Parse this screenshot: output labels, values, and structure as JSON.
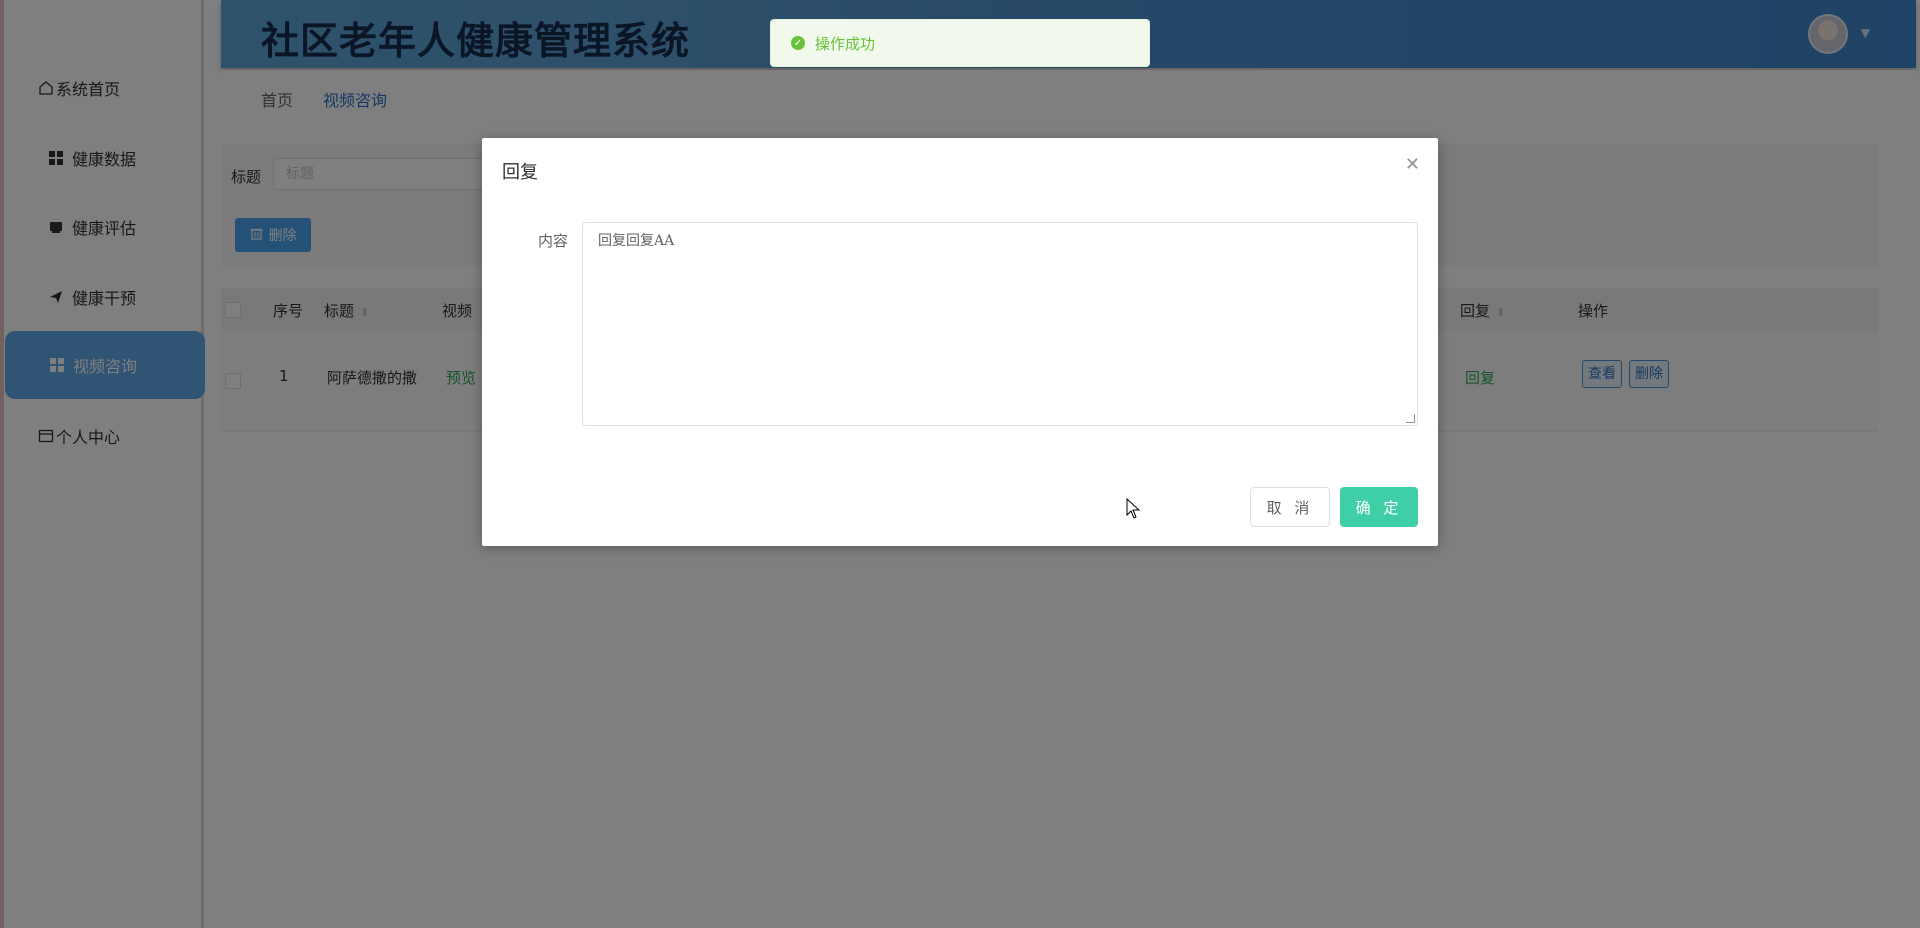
{
  "app": {
    "title": "社区老年人健康管理系统"
  },
  "sidebar": {
    "items": [
      {
        "label": "系统首页",
        "icon": "home-icon",
        "active": false
      },
      {
        "label": "健康数据",
        "icon": "grid-icon",
        "active": false
      },
      {
        "label": "健康评估",
        "icon": "card-icon",
        "active": false
      },
      {
        "label": "健康干预",
        "icon": "send-icon",
        "active": false
      },
      {
        "label": "视频咨询",
        "icon": "grid-icon",
        "active": true
      },
      {
        "label": "个人中心",
        "icon": "window-icon",
        "active": false
      }
    ]
  },
  "breadcrumb": {
    "home": "首页",
    "current": "视频咨询"
  },
  "search": {
    "label": "标题",
    "placeholder": "标题"
  },
  "toolbar": {
    "delete_label": "删除"
  },
  "table": {
    "headers": {
      "index": "序号",
      "title": "标题",
      "video": "视频",
      "reply": "回复",
      "actions": "操作"
    },
    "rows": [
      {
        "index": "1",
        "title": "阿萨德撒的撒",
        "video": "预览",
        "reply": "回复",
        "view": "查看",
        "delete": "删除"
      }
    ]
  },
  "dialog": {
    "title": "回复",
    "field_label": "内容",
    "content": "回复回复AA",
    "cancel_label": "取 消",
    "ok_label": "确 定"
  },
  "toast": {
    "message": "操作成功"
  },
  "colors": {
    "primary": "#4ba3ee",
    "success": "#67c23a",
    "confirm": "#3fcfa7",
    "active_sidebar": "#61a8e8"
  }
}
